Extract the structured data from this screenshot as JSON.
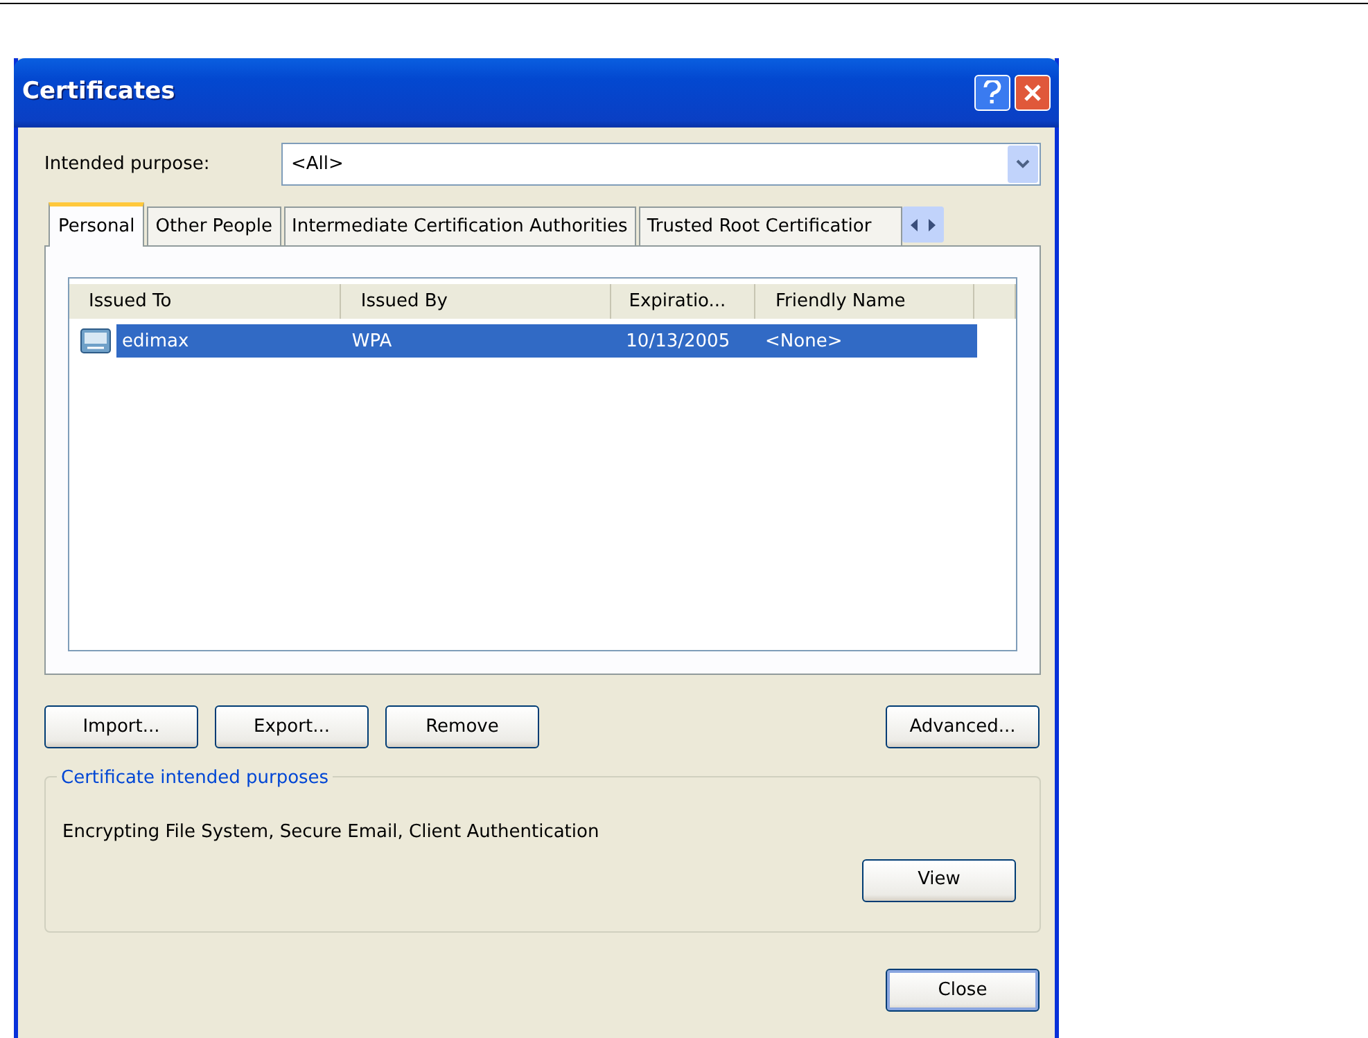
{
  "window": {
    "title": "Certificates"
  },
  "intended_purpose": {
    "label": "Intended purpose:",
    "value": "<All>"
  },
  "tabs": [
    {
      "label": "Personal",
      "selected": true
    },
    {
      "label": "Other People",
      "selected": false
    },
    {
      "label": "Intermediate Certification Authorities",
      "selected": false
    },
    {
      "label": "Trusted Root Certificatior",
      "selected": false
    }
  ],
  "table": {
    "columns": [
      "Issued To",
      "Issued By",
      "Expiratio...",
      "Friendly Name"
    ],
    "rows": [
      {
        "cells": [
          "edimax",
          "WPA",
          "10/13/2005",
          "<None>"
        ],
        "selected": true
      }
    ]
  },
  "buttons": [
    "Import...",
    "Export...",
    "Remove"
  ],
  "advanced_button": "Advanced...",
  "purposes_group": {
    "title": "Certificate intended purposes",
    "text": "Encrypting File System, Secure Email, Client Authentication",
    "button": "View"
  },
  "close_button": "Close"
}
